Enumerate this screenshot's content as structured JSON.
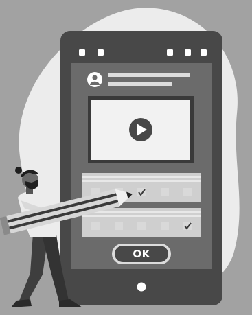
{
  "illustration": {
    "ok_button_label": "OK",
    "video_play_icon": "play-icon",
    "checkbox_rows": [
      {
        "checked": [
          false,
          false,
          true,
          false,
          false
        ]
      },
      {
        "checked": [
          false,
          false,
          false,
          false,
          true
        ]
      }
    ]
  },
  "colors": {
    "background": "#a2a2a2",
    "blob": "#ececec",
    "phone_body": "#484848",
    "screen": "#6b6b6b",
    "panel": "#cfcfcf",
    "accent_light": "#e5e5e5"
  }
}
